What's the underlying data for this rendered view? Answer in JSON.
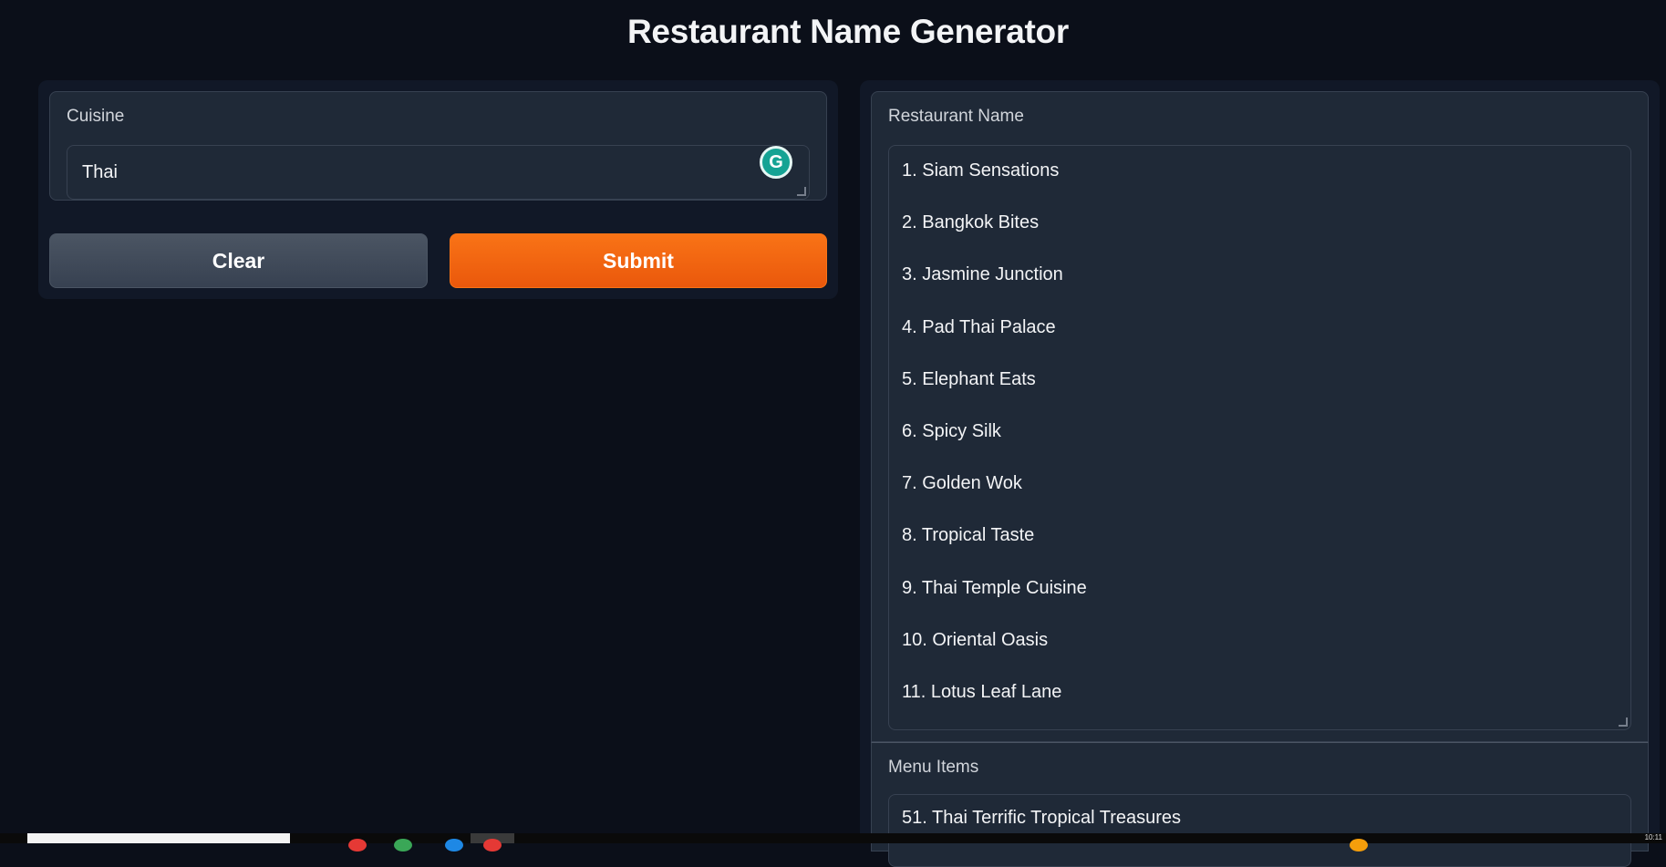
{
  "header": {
    "title": "Restaurant Name Generator"
  },
  "input_panel": {
    "cuisine_label": "Cuisine",
    "cuisine_value": "Thai",
    "grammarly_glyph": "G",
    "clear_label": "Clear",
    "submit_label": "Submit"
  },
  "output_panel": {
    "restaurant_name_label": "Restaurant Name",
    "restaurant_names": [
      "1. Siam Sensations",
      "2. Bangkok Bites",
      "3. Jasmine Junction",
      "4. Pad Thai Palace",
      "5. Elephant Eats",
      "6. Spicy Silk",
      "7. Golden Wok",
      "8. Tropical Taste",
      "9. Thai Temple Cuisine",
      "10. Oriental Oasis",
      "11. Lotus Leaf Lane"
    ],
    "menu_items_label": "Menu Items",
    "menu_items_first": "51. Thai Terrific Tropical Treasures"
  },
  "taskbar": {
    "clock": "10:11"
  },
  "colors": {
    "background": "#0b0f19",
    "panel": "#111827",
    "block": "#1f2937",
    "accent_orange": "#f97316",
    "secondary_gray": "#4b5563",
    "grammarly_green": "#15a394"
  }
}
